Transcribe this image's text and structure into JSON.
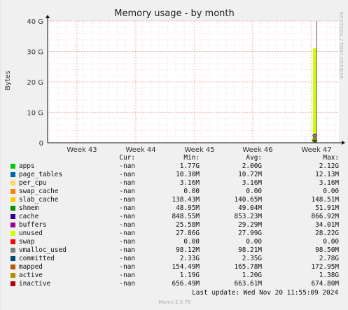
{
  "chart_data": {
    "type": "area",
    "title": "Memory usage - by month",
    "ylabel": "Bytes",
    "side_text": "RRDTOOL / TOBI OETIKER",
    "y_ticks": [
      "0",
      "10 G",
      "20 G",
      "30 G",
      "40 G"
    ],
    "y_tick_values": [
      0,
      10,
      20,
      30,
      40
    ],
    "ylim": [
      0,
      40
    ],
    "y_unit": "G",
    "x_ticks": [
      "Week 43",
      "Week 44",
      "Week 45",
      "Week 46",
      "Week 47"
    ],
    "grid": true,
    "legend_position": "bottom",
    "stack_series": [
      {
        "name": "apps",
        "color": "#00cc00",
        "value": 2.0
      },
      {
        "name": "page_tables",
        "color": "#0066b3",
        "value": 0.01
      },
      {
        "name": "per_cpu",
        "color": "#ff8000",
        "value": 0.003
      },
      {
        "name": "swap_cache",
        "color": "#ffcc00",
        "value": 0
      },
      {
        "name": "slab_cache",
        "color": "#330099",
        "value": 0.14
      },
      {
        "name": "cache",
        "color": "#990099",
        "value": 0.85
      },
      {
        "name": "buffers",
        "color": "#ccff00",
        "value": 0.03
      },
      {
        "name": "unused",
        "color": "#ccff00",
        "value": 27.99
      },
      {
        "name": "swap",
        "color": "#ff0000",
        "value": 0
      }
    ],
    "line_series": [
      {
        "name": "committed",
        "color": "#808080",
        "value": 2.35
      },
      {
        "name": "active",
        "color": "#b8860b",
        "value": 1.2
      },
      {
        "name": "inactive",
        "color": "#8b0000",
        "value": 0.66
      }
    ]
  },
  "legend": {
    "headers": {
      "cur": "Cur:",
      "min": "Min:",
      "avg": "Avg:",
      "max": "Max:"
    },
    "rows": [
      {
        "name": "apps",
        "color": "#00cc00",
        "cur": "-nan",
        "min": "1.77G",
        "avg": "2.00G",
        "max": "2.12G"
      },
      {
        "name": "page_tables",
        "color": "#0066b3",
        "cur": "-nan",
        "min": "10.30M",
        "avg": "10.72M",
        "max": "12.13M"
      },
      {
        "name": "per_cpu",
        "color": "#ffd966",
        "cur": "-nan",
        "min": "3.16M",
        "avg": "3.16M",
        "max": "3.16M"
      },
      {
        "name": "swap_cache",
        "color": "#ff8000",
        "cur": "-nan",
        "min": "0.00",
        "avg": "0.00",
        "max": "0.00"
      },
      {
        "name": "slab_cache",
        "color": "#ffcc00",
        "cur": "-nan",
        "min": "138.43M",
        "avg": "140.65M",
        "max": "148.51M"
      },
      {
        "name": "shmem",
        "color": "#008f00",
        "cur": "-nan",
        "min": "48.95M",
        "avg": "49.04M",
        "max": "51.91M"
      },
      {
        "name": "cache",
        "color": "#330099",
        "cur": "-nan",
        "min": "848.55M",
        "avg": "853.23M",
        "max": "866.92M"
      },
      {
        "name": "buffers",
        "color": "#990099",
        "cur": "-nan",
        "min": "25.58M",
        "avg": "29.29M",
        "max": "34.01M"
      },
      {
        "name": "unused",
        "color": "#ccff00",
        "cur": "-nan",
        "min": "27.86G",
        "avg": "27.99G",
        "max": "28.22G"
      },
      {
        "name": "swap",
        "color": "#ff0000",
        "cur": "-nan",
        "min": "0.00",
        "avg": "0.00",
        "max": "0.00"
      },
      {
        "name": "vmalloc_used",
        "color": "#808080",
        "cur": "-nan",
        "min": "98.12M",
        "avg": "98.21M",
        "max": "98.50M"
      },
      {
        "name": "committed",
        "color": "#004b73",
        "cur": "-nan",
        "min": "2.33G",
        "avg": "2.35G",
        "max": "2.78G"
      },
      {
        "name": "mapped",
        "color": "#b35a00",
        "cur": "-nan",
        "min": "154.49M",
        "avg": "165.78M",
        "max": "172.95M"
      },
      {
        "name": "active",
        "color": "#b38f00",
        "cur": "-nan",
        "min": "1.19G",
        "avg": "1.20G",
        "max": "1.38G"
      },
      {
        "name": "inactive",
        "color": "#b30000",
        "cur": "-nan",
        "min": "656.49M",
        "avg": "663.61M",
        "max": "674.80M"
      }
    ]
  },
  "footer": {
    "last_update": "Last update: Wed Nov 20 11:55:09 2024",
    "munin": "Munin 2.0.76"
  }
}
